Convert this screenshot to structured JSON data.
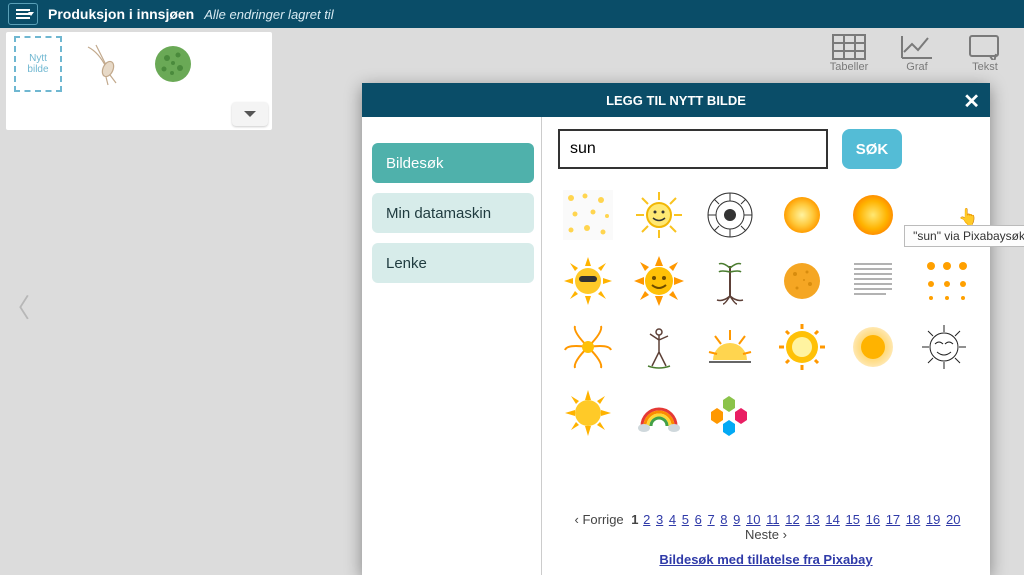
{
  "header": {
    "doc_title": "Produksjon i innsjøen",
    "save_status": "Alle endringer lagret til"
  },
  "insert": {
    "new_image_label": "Nytt bilde"
  },
  "tools": {
    "tables": "Tabeller",
    "graph": "Graf",
    "text": "Tekst"
  },
  "modal": {
    "title": "LEGG TIL NYTT BILDE",
    "tabs": {
      "search": "Bildesøk",
      "computer": "Min datamaskin",
      "link": "Lenke"
    },
    "search": {
      "value": "sun",
      "button": "SØK"
    },
    "tooltip": "\"sun\" via Pixabaysøk",
    "pagination": {
      "prev": "‹ Forrige",
      "current": "1",
      "pages": [
        "2",
        "3",
        "4",
        "5",
        "6",
        "7",
        "8",
        "9",
        "10",
        "11",
        "12",
        "13",
        "14",
        "15",
        "16",
        "17",
        "18",
        "19",
        "20"
      ],
      "next": "Neste ›"
    },
    "attribution": "Bildesøk med tillatelse fra Pixabay"
  }
}
